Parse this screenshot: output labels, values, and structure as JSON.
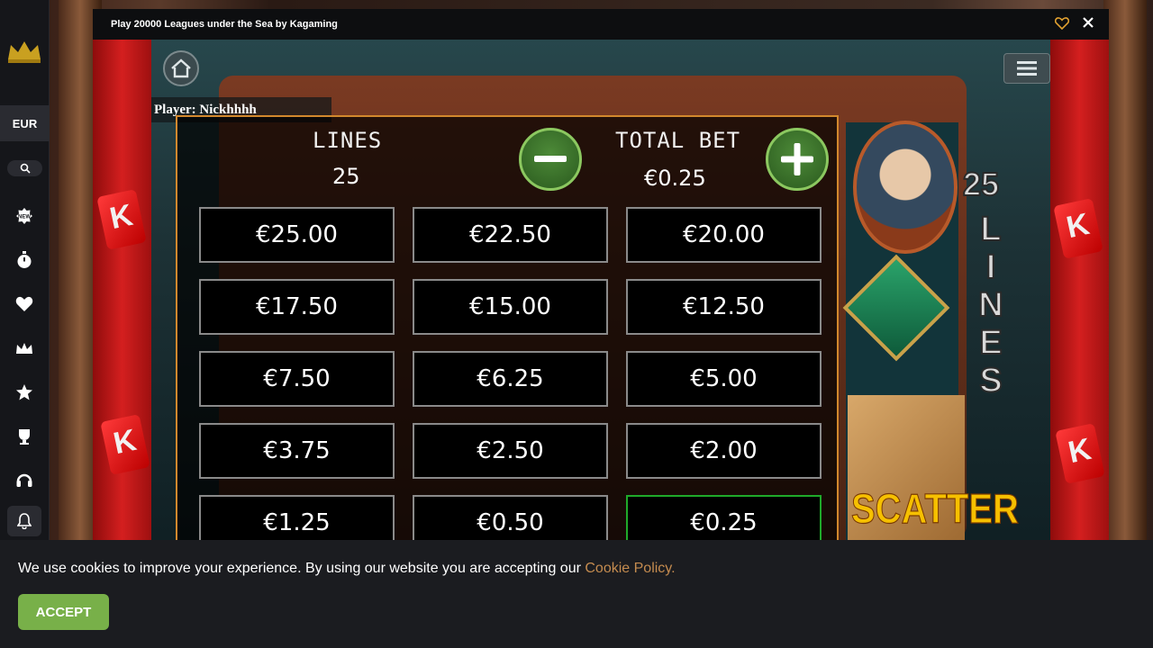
{
  "sidebar": {
    "currency": "EUR",
    "icons": [
      "crown-logo-icon",
      "search-icon",
      "new-badge-icon",
      "stopwatch-icon",
      "heart-icon",
      "crown-icon",
      "star-icon",
      "trophy-icon",
      "headset-icon",
      "bell-icon"
    ]
  },
  "modal": {
    "title": "Play 20000 Leagues under the Sea by Kagaming"
  },
  "game": {
    "player_label": "Player: Nickhhhh",
    "lines_label": "LINES",
    "lines_value": "25",
    "total_bet_label": "TOTAL BET",
    "total_bet_value": "€0.25",
    "minus_label": "−",
    "plus_label": "+",
    "side_lines_number": "25",
    "side_lines_text": "LINES",
    "scatter_text": "SCATTER",
    "bet_options": [
      {
        "label": "€25.00"
      },
      {
        "label": "€22.50"
      },
      {
        "label": "€20.00"
      },
      {
        "label": "€17.50"
      },
      {
        "label": "€15.00"
      },
      {
        "label": "€12.50"
      },
      {
        "label": "€7.50"
      },
      {
        "label": "€6.25"
      },
      {
        "label": "€5.00"
      },
      {
        "label": "€3.75"
      },
      {
        "label": "€2.50"
      },
      {
        "label": "€2.00"
      },
      {
        "label": "€1.25"
      },
      {
        "label": "€0.50"
      },
      {
        "label": "€0.25"
      }
    ],
    "selected_bet": "€0.25"
  },
  "cookie": {
    "text": "We use cookies to improve your experience. By using our website you are accepting our ",
    "link": "Cookie Policy.",
    "accept_label": "ACCEPT"
  },
  "colors": {
    "accent_gold": "#d2882d",
    "accept_green": "#78b049",
    "link_orange": "#c48b4f",
    "selected_border": "#1faa2a"
  }
}
